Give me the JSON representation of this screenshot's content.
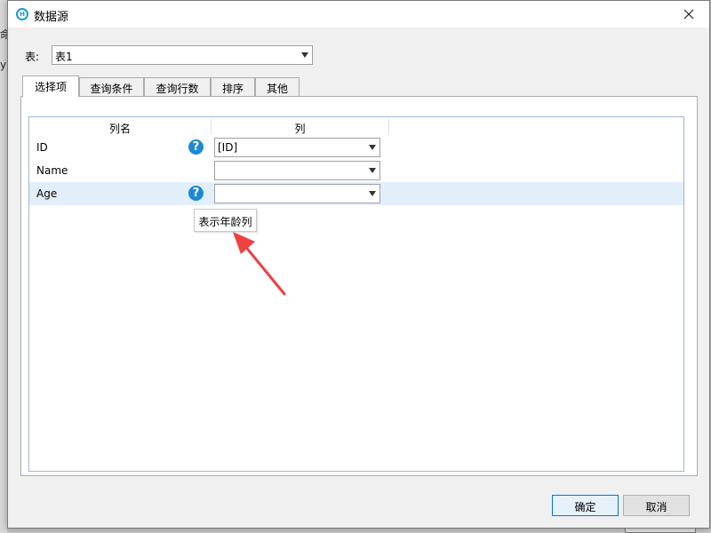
{
  "background": {
    "glyph_1": "命",
    "glyph_2": "y"
  },
  "window": {
    "title": "数据源",
    "icon": "hzgrapher-app-icon",
    "icon_letter": "H",
    "close_icon": "close-icon"
  },
  "table_select": {
    "label": "表:",
    "value": "表1"
  },
  "tabs": [
    {
      "label": "选择项",
      "active": true
    },
    {
      "label": "查询条件",
      "active": false
    },
    {
      "label": "查询行数",
      "active": false
    },
    {
      "label": "排序",
      "active": false
    },
    {
      "label": "其他",
      "active": false
    }
  ],
  "grid": {
    "headers": [
      "列名",
      "列"
    ],
    "rows": [
      {
        "name": "ID",
        "has_help": true,
        "value": "[ID]",
        "selected": false
      },
      {
        "name": "Name",
        "has_help": false,
        "value": "",
        "selected": false
      },
      {
        "name": "Age",
        "has_help": true,
        "value": "",
        "selected": true
      }
    ],
    "help_glyph": "?"
  },
  "tooltip": {
    "text": "表示年龄列"
  },
  "buttons": {
    "ok": "确定",
    "cancel": "取消"
  },
  "colors": {
    "accent": "#1a9bd7",
    "help_icon": "#1c8ad2",
    "selected_row": "#e3eefb",
    "annotation_arrow": "#f04040"
  }
}
